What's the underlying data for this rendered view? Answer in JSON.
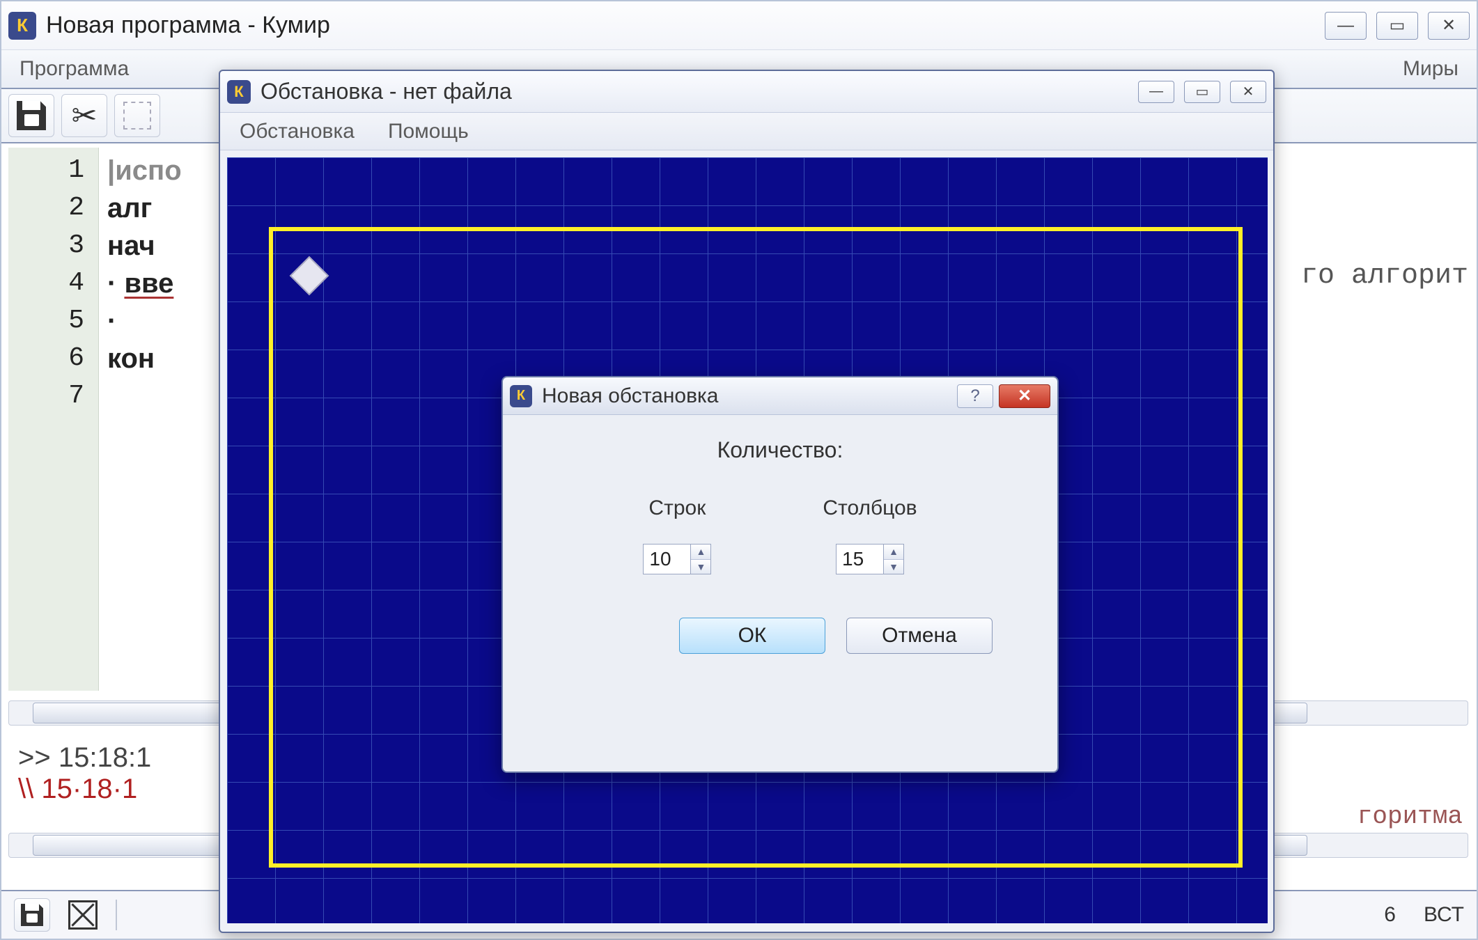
{
  "main": {
    "title": "Новая программа - Кумир",
    "menubar": {
      "program": "Программа",
      "worlds": "Миры"
    },
    "code_lines": [
      "испо",
      "алг",
      "нач",
      "вве",
      "",
      "кон",
      ""
    ],
    "side_text": "го алгорит",
    "console": {
      "prompt": ">>",
      "line1": "15:18:1",
      "line2_prefix": "\\\\",
      "line2": "15·18·1",
      "side": "горитма"
    },
    "status": {
      "col": "6",
      "mode": "ВСТ"
    }
  },
  "env": {
    "title": "Обстановка - нет файла",
    "menubar": {
      "env": "Обстановка",
      "help": "Помощь"
    }
  },
  "dialog": {
    "title": "Новая обстановка",
    "heading": "Количество:",
    "rows_label": "Строк",
    "cols_label": "Столбцов",
    "rows_value": "10",
    "cols_value": "15",
    "ok": "ОК",
    "cancel": "Отмена"
  }
}
